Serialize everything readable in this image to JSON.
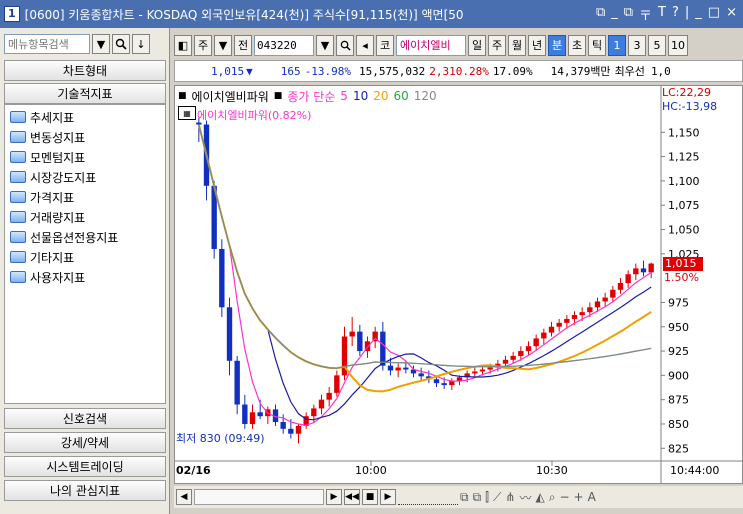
{
  "window": {
    "number": "1",
    "title": "[0600] 키움종합차트 - KOSDAQ 외국인보유[424(천)] 주식수[91,115(천)] 액면[50",
    "controls": [
      "⧉",
      "_",
      "⧉",
      "〒",
      "T",
      "?",
      "|",
      "_",
      "□",
      "×"
    ]
  },
  "sidebar": {
    "search_placeholder": "메뉴항목검색",
    "header_chart_type": "차트형태",
    "header_tech": "기술적지표",
    "tree_items": [
      "추세지표",
      "변동성지표",
      "모멘텀지표",
      "시장강도지표",
      "가격지표",
      "거래량지표",
      "선물옵션전용지표",
      "기타지표",
      "사용자지표"
    ],
    "bottom_items": [
      "신호검색",
      "강세/약세",
      "시스템트레이딩",
      "나의 관심지표"
    ]
  },
  "toolbar": {
    "period": "주",
    "prev_label": "전",
    "code": "043220",
    "market_label": "코",
    "stock_name": "에이치엘비",
    "tabs": [
      "일",
      "주",
      "월",
      "년",
      "분",
      "초",
      "틱"
    ],
    "active_tab": "분",
    "multiples": [
      "1",
      "3",
      "5",
      "10"
    ],
    "active_multiple": "1"
  },
  "infobar": {
    "price": "1,015",
    "arrow": "▼",
    "change": "165",
    "change_pct": "-13.98%",
    "volume": "15,575,032",
    "volume_ratio": "2,310.28%",
    "turnover": "17.09%",
    "amount": "14,379백만",
    "best_label": "최우선",
    "best_value": "1,0"
  },
  "chart": {
    "legend_name": "에이치엘비파워",
    "legend_ma": "종가 단순",
    "ma_periods": [
      "5",
      "10",
      "20",
      "60",
      "120"
    ],
    "ma_colors": [
      "#ff33cc",
      "#1a1aaa",
      "#f0a000",
      "#22aa44",
      "#888888"
    ],
    "lc_label": "LC:22,29",
    "hc_label": "HC:-13,98",
    "overlay_text": "에이치엘비파워(0.82%)",
    "current_price_label": "1,015",
    "current_pct_label": "1.50%",
    "min_label": "최저 830 (09:49)",
    "date_label": "02/16",
    "time_labels": [
      "10:00",
      "10:30"
    ],
    "last_time": "10:44:00"
  },
  "chart_data": {
    "type": "candlestick",
    "y_ticks": [
      1150,
      1125,
      1100,
      1075,
      1050,
      1025,
      975,
      950,
      925,
      900,
      875,
      850,
      825
    ],
    "ylim": [
      815,
      1175
    ],
    "candles": [
      [
        1160,
        1165,
        1140,
        1158
      ],
      [
        1158,
        1162,
        1080,
        1095
      ],
      [
        1095,
        1100,
        1020,
        1030
      ],
      [
        1030,
        1040,
        960,
        970
      ],
      [
        970,
        980,
        900,
        915
      ],
      [
        915,
        920,
        860,
        870
      ],
      [
        870,
        880,
        845,
        850
      ],
      [
        850,
        870,
        845,
        862
      ],
      [
        862,
        875,
        855,
        858
      ],
      [
        858,
        868,
        850,
        865
      ],
      [
        865,
        870,
        848,
        852
      ],
      [
        852,
        860,
        840,
        845
      ],
      [
        845,
        855,
        835,
        840
      ],
      [
        840,
        850,
        830,
        848
      ],
      [
        848,
        862,
        845,
        858
      ],
      [
        858,
        870,
        852,
        866
      ],
      [
        866,
        880,
        860,
        875
      ],
      [
        875,
        888,
        868,
        882
      ],
      [
        882,
        905,
        878,
        900
      ],
      [
        900,
        950,
        895,
        940
      ],
      [
        940,
        960,
        930,
        945
      ],
      [
        945,
        952,
        920,
        925
      ],
      [
        925,
        940,
        918,
        935
      ],
      [
        935,
        950,
        928,
        945
      ],
      [
        945,
        955,
        905,
        910
      ],
      [
        910,
        918,
        900,
        905
      ],
      [
        905,
        912,
        898,
        908
      ],
      [
        908,
        915,
        902,
        906
      ],
      [
        906,
        910,
        898,
        902
      ],
      [
        902,
        908,
        895,
        899
      ],
      [
        899,
        905,
        892,
        896
      ],
      [
        896,
        900,
        888,
        892
      ],
      [
        892,
        898,
        886,
        890
      ],
      [
        890,
        897,
        885,
        894
      ],
      [
        894,
        900,
        890,
        898
      ],
      [
        898,
        905,
        893,
        902
      ],
      [
        902,
        908,
        898,
        904
      ],
      [
        904,
        910,
        900,
        906
      ],
      [
        906,
        912,
        902,
        908
      ],
      [
        908,
        916,
        904,
        912
      ],
      [
        912,
        920,
        908,
        916
      ],
      [
        916,
        924,
        912,
        920
      ],
      [
        920,
        930,
        915,
        925
      ],
      [
        925,
        935,
        920,
        930
      ],
      [
        930,
        942,
        925,
        938
      ],
      [
        938,
        948,
        932,
        944
      ],
      [
        944,
        955,
        940,
        950
      ],
      [
        950,
        958,
        945,
        954
      ],
      [
        954,
        962,
        948,
        958
      ],
      [
        958,
        966,
        952,
        962
      ],
      [
        962,
        970,
        956,
        965
      ],
      [
        965,
        975,
        960,
        970
      ],
      [
        970,
        980,
        965,
        976
      ],
      [
        976,
        985,
        970,
        980
      ],
      [
        980,
        992,
        975,
        988
      ],
      [
        988,
        1000,
        984,
        995
      ],
      [
        995,
        1008,
        990,
        1004
      ],
      [
        1004,
        1015,
        998,
        1010
      ],
      [
        1010,
        1018,
        1002,
        1006
      ],
      [
        1006,
        1016,
        1000,
        1015
      ]
    ]
  }
}
